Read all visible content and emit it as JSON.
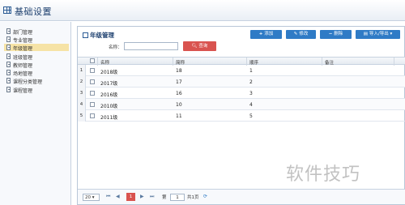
{
  "header": {
    "title": "基础设置"
  },
  "sidebar": {
    "items": [
      {
        "label": "部门管理"
      },
      {
        "label": "专业管理"
      },
      {
        "label": "年级管理"
      },
      {
        "label": "班级管理"
      },
      {
        "label": "教师管理"
      },
      {
        "label": "场地管理"
      },
      {
        "label": "课程分类管理"
      },
      {
        "label": "课程管理"
      }
    ]
  },
  "panel": {
    "title": "年级管理",
    "toolbar": {
      "add": "添加",
      "edit": "修改",
      "delete": "删除",
      "import_export": "导入/导出"
    },
    "search": {
      "label": "名称：",
      "value": "",
      "button": "查询"
    }
  },
  "table": {
    "columns": [
      "名称",
      "简称",
      "顺序",
      "备注"
    ],
    "rows": [
      {
        "num": "1",
        "name": "2018级",
        "short": "18",
        "order": "1",
        "note": ""
      },
      {
        "num": "2",
        "name": "2017级",
        "short": "17",
        "order": "2",
        "note": ""
      },
      {
        "num": "3",
        "name": "2016级",
        "short": "16",
        "order": "3",
        "note": ""
      },
      {
        "num": "4",
        "name": "2010级",
        "short": "10",
        "order": "4",
        "note": ""
      },
      {
        "num": "5",
        "name": "2011级",
        "short": "11",
        "order": "5",
        "note": ""
      }
    ]
  },
  "pager": {
    "page_size": "20",
    "current": "1",
    "page_label": "第",
    "page_input": "1",
    "total": "共1页"
  },
  "watermark": "软件技巧"
}
